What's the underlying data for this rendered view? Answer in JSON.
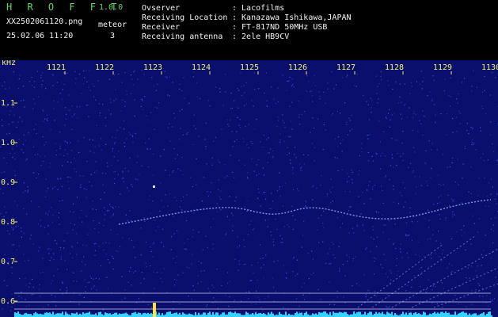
{
  "app": {
    "name": "H R O F F T",
    "version": "1.0.0",
    "filename": "XX2502061120.png",
    "datetime": "25.02.06 11:20",
    "count_label": "meteor",
    "count_value": "3"
  },
  "info": {
    "rows": [
      {
        "label": "Ovserver",
        "value": ": Lacofilms"
      },
      {
        "label": "Receiving Location",
        "value": ": Kanazawa Ishikawa,JAPAN"
      },
      {
        "label": "Receiver",
        "value": ": FT-817ND 50MHz USB"
      },
      {
        "label": "Receiving antenna",
        "value": ": 2ele HB9CV"
      }
    ]
  },
  "spectrogram": {
    "unit_label": "kHz",
    "time_ticks": [
      "1121",
      "1122",
      "1123",
      "1124",
      "1125",
      "1126",
      "1127",
      "1128",
      "1129",
      "1130"
    ],
    "freq_ticks": [
      {
        "label": "1.1",
        "value": 1.1
      },
      {
        "label": "1.0",
        "value": 1.0
      },
      {
        "label": "0.9",
        "value": 0.9
      },
      {
        "label": "0.8",
        "value": 0.8
      },
      {
        "label": "0.7",
        "value": 0.7
      },
      {
        "label": "0.6",
        "value": 0.6
      }
    ],
    "colors": {
      "background": "#0a0f6e",
      "noise": "#4a62ff",
      "trace": "#9db6ff",
      "baseline": "#34d3ff",
      "burst": "#ffe23a",
      "axis_text": "#f3f36a",
      "ref_line": "#f0f0ff"
    }
  }
}
